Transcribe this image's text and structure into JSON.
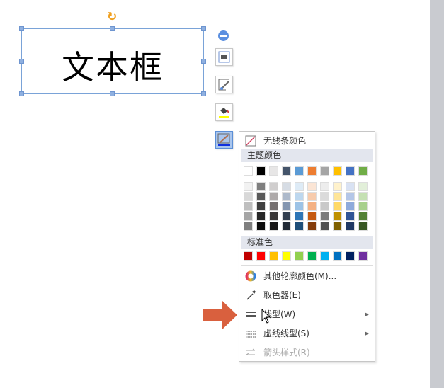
{
  "textbox": {
    "text": "文本框"
  },
  "menu": {
    "no_line": "无线条颜色",
    "theme_header": "主题颜色",
    "standard_header": "标准色",
    "more_colors": "其他轮廓颜色(M)...",
    "eyedropper": "取色器(E)",
    "line_style": "线型(W)",
    "dash_style": "虚线线型(S)",
    "arrow_style": "箭头样式(R)"
  },
  "theme_colors": [
    "#ffffff",
    "#000000",
    "#e7e6e6",
    "#44546a",
    "#5b9bd5",
    "#ed7d31",
    "#a5a5a5",
    "#ffc000",
    "#4472c4",
    "#70ad47"
  ],
  "theme_shades": [
    [
      "#f2f2f2",
      "#7f7f7f",
      "#d0cece",
      "#d6dce4",
      "#deebf6",
      "#fbe5d5",
      "#ededed",
      "#fff2cc",
      "#d9e2f3",
      "#e2efd9"
    ],
    [
      "#d8d8d8",
      "#595959",
      "#aeaaaa",
      "#adb9ca",
      "#bdd7ee",
      "#f7cbac",
      "#dbdbdb",
      "#fee599",
      "#b4c6e7",
      "#c5e0b3"
    ],
    [
      "#bfbfbf",
      "#3f3f3f",
      "#757070",
      "#8496b0",
      "#9dc3e6",
      "#f4b183",
      "#c9c9c9",
      "#ffd966",
      "#8eaadb",
      "#a8d08d"
    ],
    [
      "#a5a5a5",
      "#262626",
      "#3a3838",
      "#323f4f",
      "#2e75b5",
      "#c55a11",
      "#7b7b7b",
      "#bf9000",
      "#2f5496",
      "#538135"
    ],
    [
      "#7f7f7f",
      "#0c0c0c",
      "#171616",
      "#222a35",
      "#1e4e79",
      "#833c0b",
      "#525252",
      "#7f6000",
      "#1f3864",
      "#375623"
    ]
  ],
  "standard_colors": [
    "#c00000",
    "#ff0000",
    "#ffc000",
    "#ffff00",
    "#92d050",
    "#00b050",
    "#00b0f0",
    "#0070c0",
    "#002060",
    "#7030a0"
  ]
}
